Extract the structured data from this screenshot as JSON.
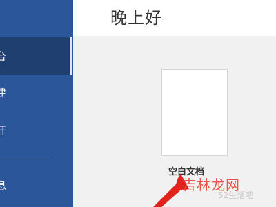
{
  "sidebar": {
    "items": [
      {
        "label": "台"
      },
      {
        "label": "建"
      },
      {
        "label": "开"
      },
      {
        "label": "息"
      }
    ]
  },
  "header": {
    "greeting": "晚上好"
  },
  "main": {
    "blank_doc_label": "空白文档"
  },
  "watermark": {
    "brand": "吉林龙网",
    "sub": "52生活吧"
  },
  "colors": {
    "sidebar": "#2b579a",
    "sidebar_active": "#1f3f70",
    "arrow": "#e0241b"
  }
}
